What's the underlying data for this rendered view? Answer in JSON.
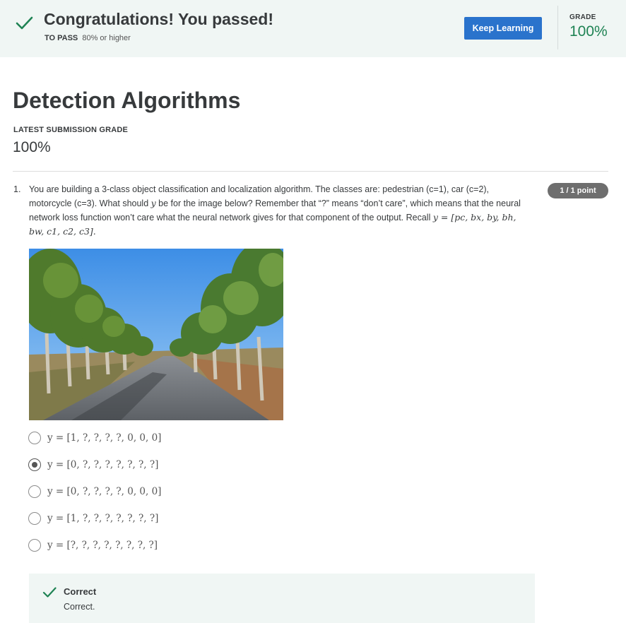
{
  "banner": {
    "title": "Congratulations! You passed!",
    "pass_label": "TO PASS",
    "pass_value": "80% or higher",
    "keep_button": "Keep Learning",
    "grade_label": "GRADE",
    "grade_value": "100%"
  },
  "page": {
    "title": "Detection Algorithms",
    "latest_label": "LATEST SUBMISSION GRADE",
    "latest_value": "100%"
  },
  "question": {
    "number": "1.",
    "text_part1": "You are building a 3-class object classification and localization algorithm. The classes are: pedestrian (c=1), car (c=2), motorcycle (c=3). What should ",
    "text_var": "y",
    "text_part2": " be for the image below? Remember that “?” means “don’t care”, which means that the neural network loss function won’t care what the neural network gives for that component of the output. Recall ",
    "text_formula": "y = [pc, bx, by, bh, bw, c1, c2, c3].",
    "points": "1 / 1 point",
    "options": [
      {
        "label": "y = [1, ?, ?, ?, ?, 0, 0, 0]",
        "selected": false
      },
      {
        "label": "y = [0, ?, ?, ?, ?, ?, ?, ?]",
        "selected": true
      },
      {
        "label": "y = [0, ?, ?, ?, ?, 0, 0, 0]",
        "selected": false
      },
      {
        "label": "y = [1, ?, ?, ?, ?, ?, ?, ?]",
        "selected": false
      },
      {
        "label": "y = [?, ?, ?, ?, ?, ?, ?, ?]",
        "selected": false
      }
    ]
  },
  "feedback": {
    "title": "Correct",
    "text": "Correct."
  },
  "colors": {
    "accent_green": "#1f8354",
    "button_blue": "#2a73cc",
    "banner_bg": "#f0f6f4"
  }
}
